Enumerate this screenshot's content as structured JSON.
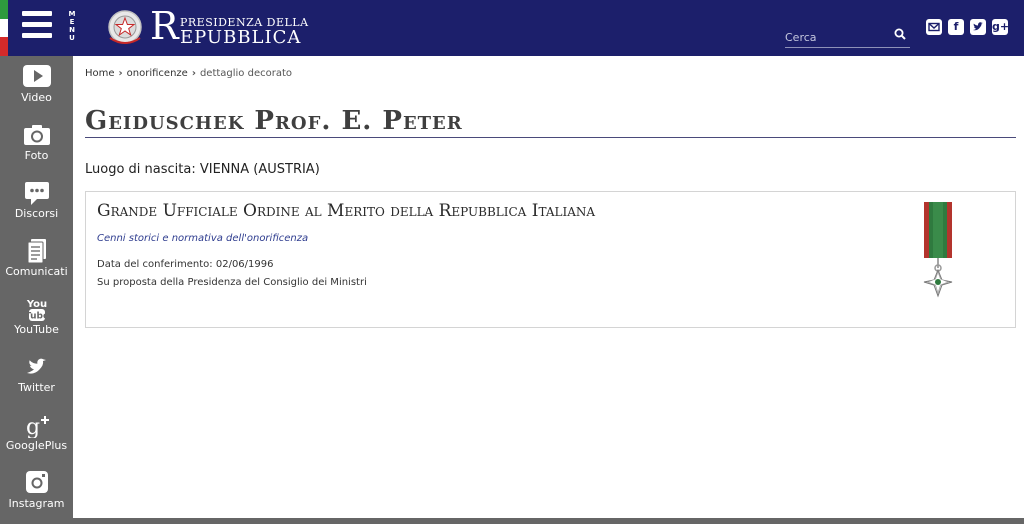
{
  "header": {
    "menu_label": "MENU",
    "logo_initial": "R",
    "logo_line1": "PRESIDENZA DELLA",
    "logo_line2": "EPUBBLICA",
    "search_placeholder": "Cerca",
    "social_icons": [
      "mail-icon",
      "facebook-icon",
      "twitter-icon",
      "googleplus-icon"
    ],
    "colors": {
      "bar": "#1c1f6b",
      "flag_green": "#2e9a3e",
      "flag_white": "#ffffff",
      "flag_red": "#d42a2a"
    }
  },
  "sidebar": {
    "items": [
      {
        "label": "Video",
        "icon": "play-icon"
      },
      {
        "label": "Foto",
        "icon": "camera-icon"
      },
      {
        "label": "Discorsi",
        "icon": "speech-bubble-icon"
      },
      {
        "label": "Comunicati",
        "icon": "document-icon"
      },
      {
        "label": "YouTube",
        "icon": "youtube-icon"
      },
      {
        "label": "Twitter",
        "icon": "twitter-bird-icon"
      },
      {
        "label": "GooglePlus",
        "icon": "googleplus-icon"
      },
      {
        "label": "Instagram",
        "icon": "instagram-icon"
      }
    ]
  },
  "breadcrumb": {
    "home": "Home",
    "section": "onorificenze",
    "current": "dettaglio decorato"
  },
  "page": {
    "title": "Geiduschek Prof. E. Peter",
    "birthplace": "Luogo di nascita: VIENNA (AUSTRIA)"
  },
  "decoration": {
    "title": "Grande Ufficiale Ordine al Merito della Repubblica Italiana",
    "link": "Cenni storici e normativa dell'onorificenza",
    "date": "Data del conferimento: 02/06/1996",
    "proposal": "Su proposta della Presidenza del Consiglio dei Ministri"
  }
}
